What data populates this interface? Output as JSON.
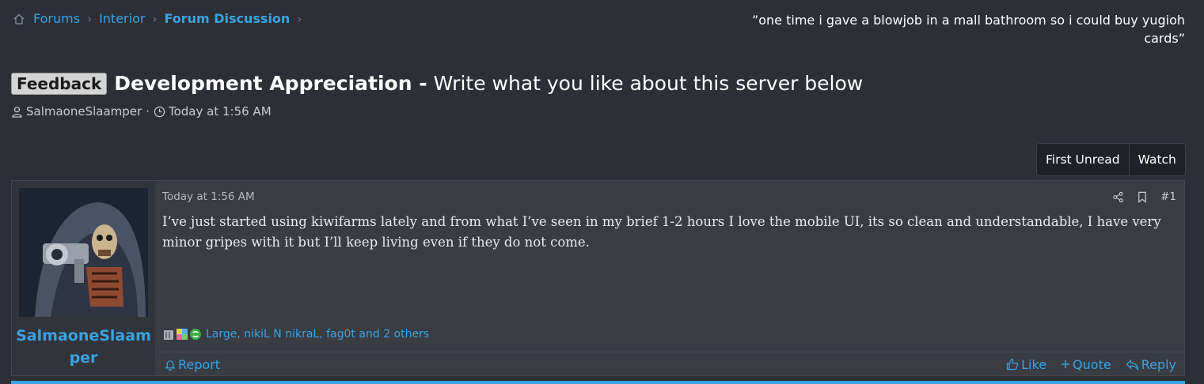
{
  "breadcrumb": {
    "items": [
      "Forums",
      "Interior",
      "Forum Discussion"
    ]
  },
  "header_quote": "”one time i gave a blowjob in a mall bathroom so i could buy yugioh cards”",
  "thread": {
    "prefix": "Feedback",
    "title": "Development Appreciation -",
    "subtitle": "Write what you like about this server below",
    "author": "SalmaoneSlaamper",
    "time": "Today at 1:56 AM",
    "meta_separator": "·"
  },
  "buttons": {
    "first_unread": "First Unread",
    "watch": "Watch"
  },
  "post": {
    "username": "SalmaoneSlaamper",
    "date": "Today at 1:56 AM",
    "number": "#1",
    "body": "I’ve just started using kiwifarms lately and from what I’ve seen in my brief 1-2 hours I love the mobile UI, its so clean and understandable, I have very minor gripes with it but I’ll keep living even if they do not come.",
    "reactions_text": "Large, nikiL N nikraL, fag0t and 2 others",
    "actions": {
      "report": "Report",
      "like": "Like",
      "quote": "Quote",
      "reply": "Reply"
    }
  },
  "colors": {
    "accent": "#3aa3e3",
    "background": "#2c2f36",
    "post_bg": "#393c43"
  }
}
